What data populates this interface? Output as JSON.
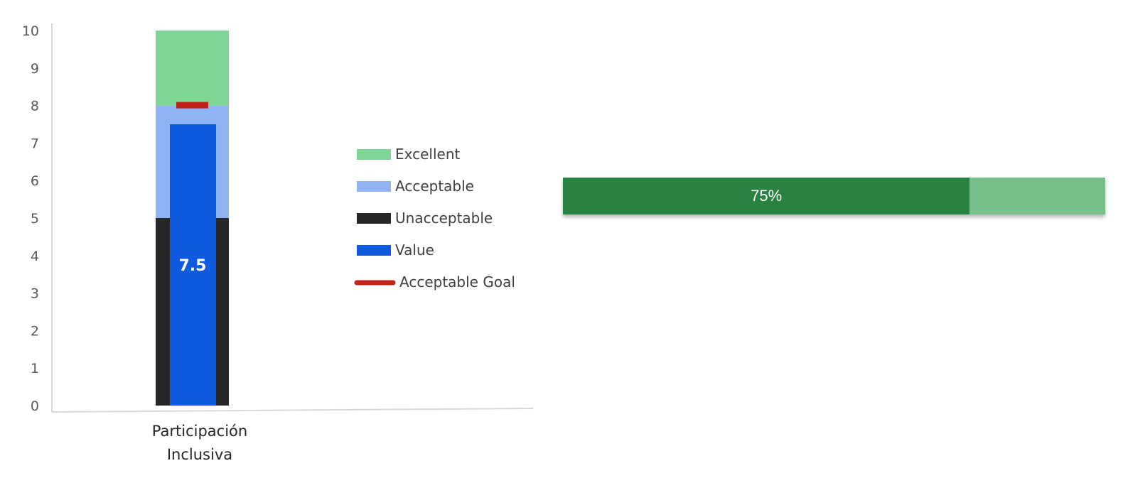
{
  "chart_data": [
    {
      "type": "bar",
      "subtype": "bullet",
      "categories": [
        "Participación Inclusiva"
      ],
      "category_lines": [
        [
          "Participación",
          "Inclusiva"
        ]
      ],
      "ylim": [
        0,
        10
      ],
      "yticks": [
        0,
        1,
        2,
        3,
        4,
        5,
        6,
        7,
        8,
        9,
        10
      ],
      "bands": [
        {
          "name": "Unacceptable",
          "from": 0,
          "to": 5,
          "color": "#262626"
        },
        {
          "name": "Acceptable",
          "from": 5,
          "to": 8,
          "color": "#8eb4f6"
        },
        {
          "name": "Excellent",
          "from": 8,
          "to": 10,
          "color": "#7dd693"
        }
      ],
      "series": [
        {
          "name": "Value",
          "values": [
            7.5
          ],
          "color": "#0f5ade",
          "label": "7.5"
        },
        {
          "name": "Acceptable Goal",
          "values": [
            8
          ],
          "color": "#c0231a"
        }
      ],
      "legend": {
        "position": "right",
        "items": [
          {
            "label": "Excellent",
            "color": "#7dd693",
            "marker": "rect"
          },
          {
            "label": "Acceptable",
            "color": "#8eb4f6",
            "marker": "rect"
          },
          {
            "label": "Unacceptable",
            "color": "#262626",
            "marker": "rect"
          },
          {
            "label": "Value",
            "color": "#0f5ade",
            "marker": "rect"
          },
          {
            "label": "Acceptable Goal",
            "color": "#c0231a",
            "marker": "line"
          }
        ]
      },
      "grid": false
    },
    {
      "type": "bar",
      "subtype": "progress",
      "value": 0.75,
      "label": "75%",
      "fill_color": "#2a8241",
      "track_color": "#79bf8c"
    }
  ]
}
